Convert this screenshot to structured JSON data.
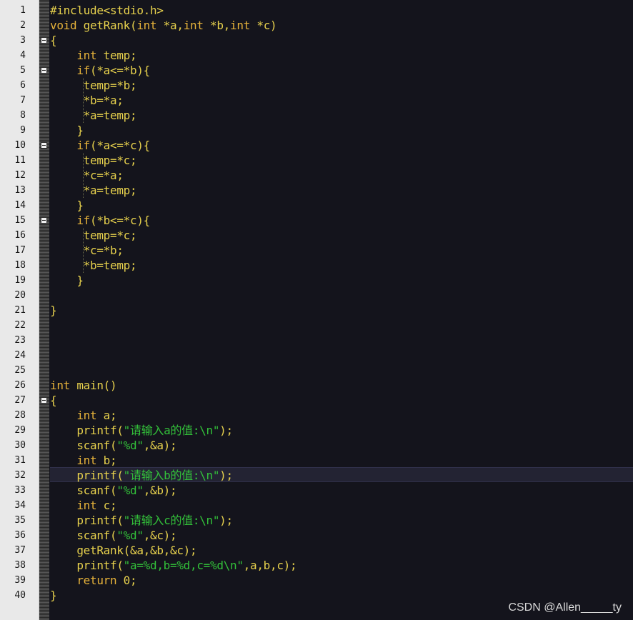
{
  "editor": {
    "language": "C",
    "current_line": 32,
    "lines": [
      {
        "n": "1",
        "fold": false,
        "text": "#include<stdio.h>"
      },
      {
        "n": "2",
        "fold": false,
        "text": "void getRank(int *a,int *b,int *c)"
      },
      {
        "n": "3",
        "fold": true,
        "text": "{"
      },
      {
        "n": "4",
        "fold": false,
        "text": "    int temp;"
      },
      {
        "n": "5",
        "fold": true,
        "text": "    if(*a<=*b){"
      },
      {
        "n": "6",
        "fold": false,
        "text": "     temp=*b;"
      },
      {
        "n": "7",
        "fold": false,
        "text": "     *b=*a;"
      },
      {
        "n": "8",
        "fold": false,
        "text": "     *a=temp;"
      },
      {
        "n": "9",
        "fold": false,
        "text": "    }"
      },
      {
        "n": "10",
        "fold": true,
        "text": "    if(*a<=*c){"
      },
      {
        "n": "11",
        "fold": false,
        "text": "     temp=*c;"
      },
      {
        "n": "12",
        "fold": false,
        "text": "     *c=*a;"
      },
      {
        "n": "13",
        "fold": false,
        "text": "     *a=temp;"
      },
      {
        "n": "14",
        "fold": false,
        "text": "    }"
      },
      {
        "n": "15",
        "fold": true,
        "text": "    if(*b<=*c){"
      },
      {
        "n": "16",
        "fold": false,
        "text": "     temp=*c;"
      },
      {
        "n": "17",
        "fold": false,
        "text": "     *c=*b;"
      },
      {
        "n": "18",
        "fold": false,
        "text": "     *b=temp;"
      },
      {
        "n": "19",
        "fold": false,
        "text": "    }"
      },
      {
        "n": "20",
        "fold": false,
        "text": ""
      },
      {
        "n": "21",
        "fold": false,
        "text": "}"
      },
      {
        "n": "22",
        "fold": false,
        "text": ""
      },
      {
        "n": "23",
        "fold": false,
        "text": ""
      },
      {
        "n": "24",
        "fold": false,
        "text": ""
      },
      {
        "n": "25",
        "fold": false,
        "text": ""
      },
      {
        "n": "26",
        "fold": false,
        "text": "int main()"
      },
      {
        "n": "27",
        "fold": true,
        "text": "{"
      },
      {
        "n": "28",
        "fold": false,
        "text": "    int a;"
      },
      {
        "n": "29",
        "fold": false,
        "text": "    printf(\"请输入a的值:\\n\");"
      },
      {
        "n": "30",
        "fold": false,
        "text": "    scanf(\"%d\",&a);"
      },
      {
        "n": "31",
        "fold": false,
        "text": "    int b;"
      },
      {
        "n": "32",
        "fold": false,
        "text": "    printf(\"请输入b的值:\\n\");"
      },
      {
        "n": "33",
        "fold": false,
        "text": "    scanf(\"%d\",&b);"
      },
      {
        "n": "34",
        "fold": false,
        "text": "    int c;"
      },
      {
        "n": "35",
        "fold": false,
        "text": "    printf(\"请输入c的值:\\n\");"
      },
      {
        "n": "36",
        "fold": false,
        "text": "    scanf(\"%d\",&c);"
      },
      {
        "n": "37",
        "fold": false,
        "text": "    getRank(&a,&b,&c);"
      },
      {
        "n": "38",
        "fold": false,
        "text": "    printf(\"a=%d,b=%d,c=%d\\n\",a,b,c);"
      },
      {
        "n": "39",
        "fold": false,
        "text": "    return 0;"
      },
      {
        "n": "40",
        "fold": false,
        "text": "}"
      }
    ]
  },
  "watermark": "CSDN @Allen_____ty",
  "colors": {
    "background": "#14141c",
    "gutter": "#e9e9e9",
    "keyword": "#e7b33a",
    "string": "#33c23a",
    "text": "#e8d24d",
    "current_line": "#232333"
  }
}
